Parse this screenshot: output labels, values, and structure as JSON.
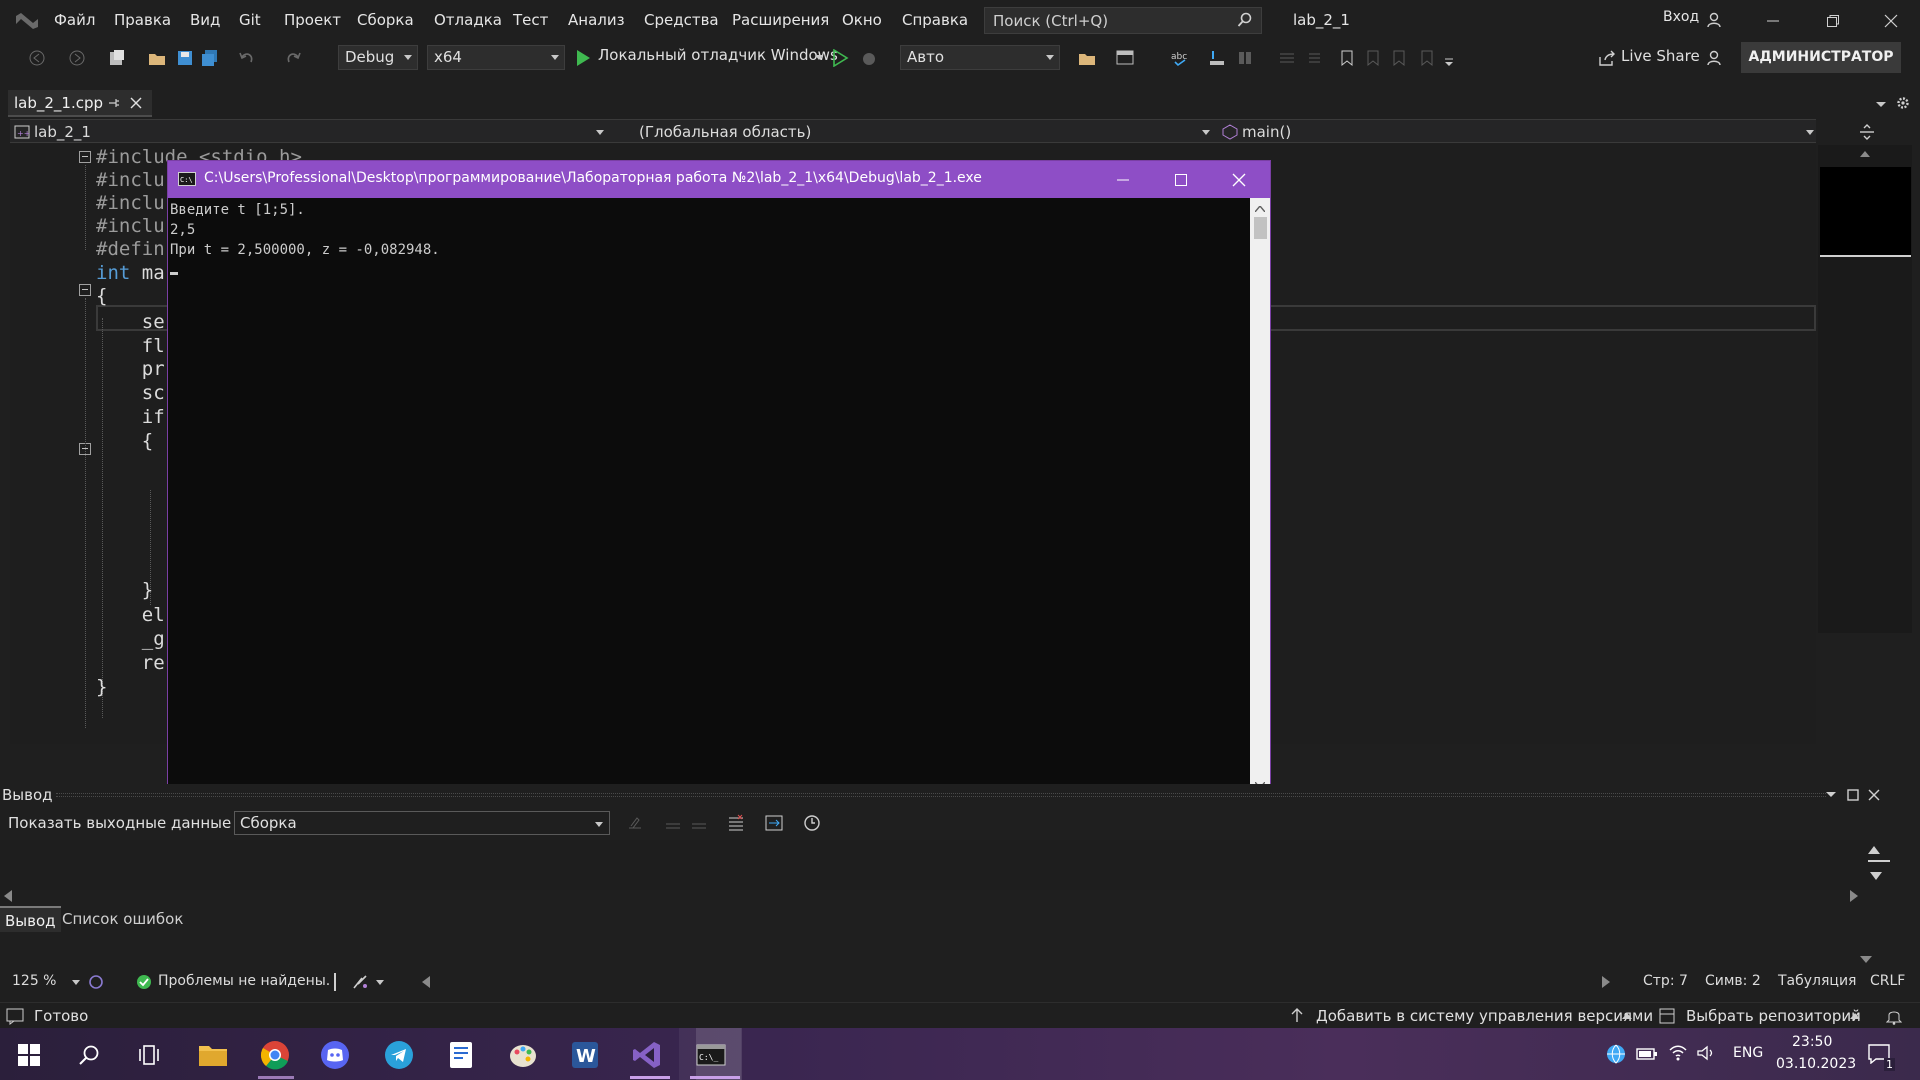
{
  "menu": {
    "items": [
      "Файл",
      "Правка",
      "Вид",
      "Git",
      "Проект",
      "Сборка",
      "Отладка",
      "Тест",
      "Анализ",
      "Средства",
      "Расширения",
      "Окно",
      "Справка"
    ],
    "search_placeholder": "Поиск (Ctrl+Q)",
    "solution_name": "lab_2_1",
    "sign_in": "Вход"
  },
  "toolbar": {
    "config": "Debug",
    "platform": "x64",
    "run_label": "Локальный отладчик Windows",
    "auto": "Авто",
    "live_share": "Live Share",
    "admin": "АДМИНИСТРАТОР"
  },
  "doc_tab": {
    "name": "lab_2_1.cpp"
  },
  "navbar": {
    "project": "lab_2_1",
    "scope": "(Глобальная область)",
    "member": "main()"
  },
  "code_lines": [
    "#include <stdio.h>",
    "#inclu",
    "#inclu",
    "#inclu",
    "#defin",
    "int ma",
    "{",
    "    se",
    "    fl",
    "    pr",
    "    sc",
    "    if",
    "    {",
    "",
    "",
    "",
    "",
    "",
    "    }",
    "    el",
    "    _g",
    "    re",
    "}"
  ],
  "console": {
    "title": "C:\\Users\\Professional\\Desktop\\программирование\\Лабораторная работа №2\\lab_2_1\\x64\\Debug\\lab_2_1.exe",
    "lines": [
      "Введите t [1;5].",
      "2,5",
      "При t = 2,500000, z = -0,082948."
    ]
  },
  "output": {
    "title": "Вывод",
    "show_from_label": "Показать выходные данные из:",
    "source": "Сборка"
  },
  "bottom_tabs": [
    "Вывод",
    "Список ошибок"
  ],
  "editor_status": {
    "zoom": "125 %",
    "problems": "Проблемы не найдены.",
    "line": "Стр: 7",
    "col": "Симв: 2",
    "indent": "Табуляция",
    "eol": "CRLF"
  },
  "statusbar": {
    "ready": "Готово",
    "add_vcs": "Добавить в систему управления версиями",
    "select_repo": "Выбрать репозиторий"
  },
  "taskbar": {
    "lang": "ENG",
    "time": "23:50",
    "date": "03.10.2023",
    "notif_count": "1"
  }
}
